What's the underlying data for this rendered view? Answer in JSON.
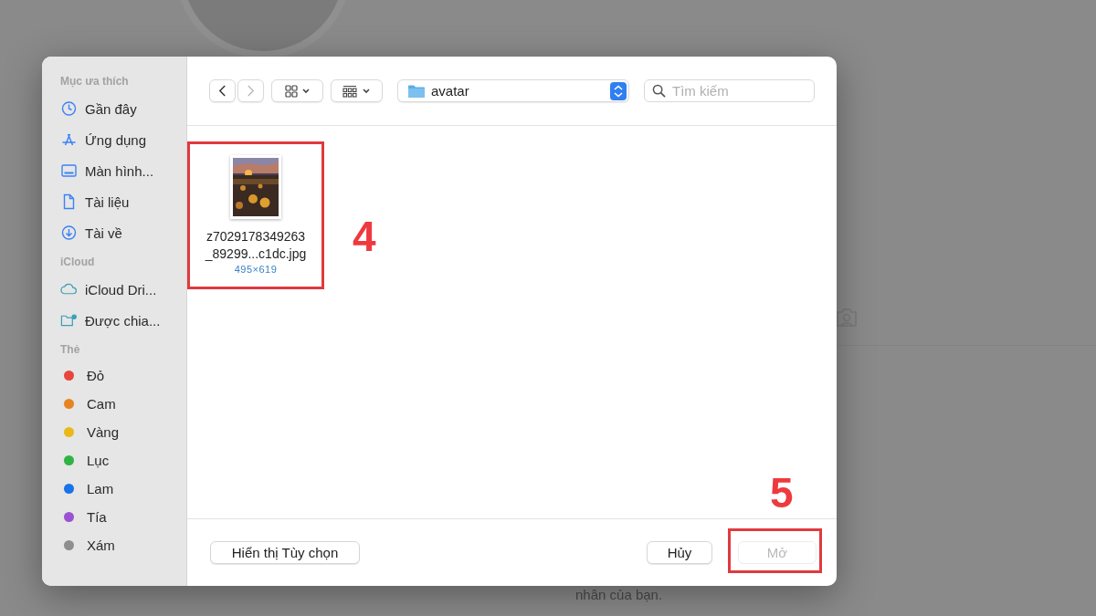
{
  "background": {
    "caption": "nhân của bạn."
  },
  "dialog": {
    "sidebar": {
      "favorites": {
        "title": "Mục ưa thích",
        "items": [
          {
            "label": "Gần đây"
          },
          {
            "label": "Ứng dụng"
          },
          {
            "label": "Màn hình..."
          },
          {
            "label": "Tài liệu"
          },
          {
            "label": "Tài về"
          }
        ]
      },
      "icloud": {
        "title": "iCloud",
        "items": [
          {
            "label": "iCloud Dri..."
          },
          {
            "label": "Được chia..."
          }
        ]
      },
      "tags": {
        "title": "Thẻ",
        "items": [
          {
            "label": "Đỏ",
            "color": "#e8453c"
          },
          {
            "label": "Cam",
            "color": "#e8841f"
          },
          {
            "label": "Vàng",
            "color": "#e9b91a"
          },
          {
            "label": "Lục",
            "color": "#2fb344"
          },
          {
            "label": "Lam",
            "color": "#1a73e8"
          },
          {
            "label": "Tía",
            "color": "#9b52d1"
          },
          {
            "label": "Xám",
            "color": "#8e8e8e"
          }
        ]
      }
    },
    "toolbar": {
      "back": {
        "disabled": false
      },
      "forward": {
        "disabled": true
      },
      "location": "avatar",
      "search": {
        "placeholder": "Tìm kiếm"
      }
    },
    "files": [
      {
        "name_lines": [
          "z7029178349263",
          "_89299...c1dc.jpg"
        ],
        "dimensions": "495×619"
      }
    ],
    "footer": {
      "options_button": "Hiển thị Tùy chọn",
      "cancel": {
        "label": "Hủy",
        "disabled": false
      },
      "open": {
        "label": "Mở",
        "disabled": true
      }
    }
  },
  "annotations": [
    {
      "label": "4"
    },
    {
      "label": "5"
    }
  ]
}
